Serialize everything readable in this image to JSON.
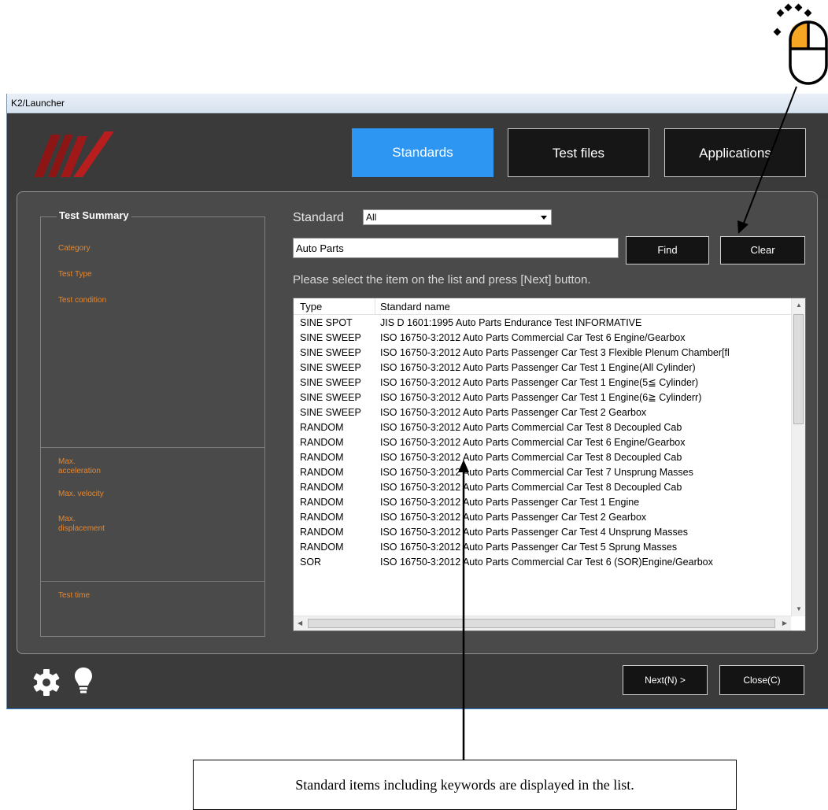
{
  "window": {
    "title": "K2/Launcher"
  },
  "tabs": [
    {
      "label": "Standards",
      "active": true
    },
    {
      "label": "Test files",
      "active": false
    },
    {
      "label": "Applications",
      "active": false
    }
  ],
  "summary": {
    "title": "Test Summary",
    "category": "Category",
    "test_type": "Test Type",
    "test_condition": "Test condition",
    "max_acceleration": "Max.\nacceleration",
    "max_velocity": "Max. velocity",
    "max_displacement": "Max.\ndisplacement",
    "test_time": "Test time"
  },
  "filter": {
    "standard_label": "Standard",
    "standard_value": "All",
    "search_value": "Auto Parts",
    "find_label": "Find",
    "clear_label": "Clear",
    "instruction": "Please select the item on the list and press [Next] button."
  },
  "list": {
    "headers": [
      "Type",
      "Standard name"
    ],
    "rows": [
      {
        "type": "SINE SPOT",
        "name": "JIS D 1601:1995 Auto Parts Endurance Test INFORMATIVE"
      },
      {
        "type": "SINE SWEEP",
        "name": "ISO 16750-3:2012 Auto Parts Commercial Car Test 6 Engine/Gearbox"
      },
      {
        "type": "SINE SWEEP",
        "name": "ISO 16750-3:2012 Auto Parts Passenger Car Test 3 Flexible Plenum Chamber[fl"
      },
      {
        "type": "SINE SWEEP",
        "name": "ISO 16750-3:2012 Auto Parts Passenger Car Test 1 Engine(All Cylinder)"
      },
      {
        "type": "SINE SWEEP",
        "name": "ISO 16750-3:2012 Auto Parts Passenger Car Test 1 Engine(5≦ Cylinder)"
      },
      {
        "type": "SINE SWEEP",
        "name": "ISO 16750-3:2012 Auto Parts Passenger Car Test 1 Engine(6≧ Cylinderr)"
      },
      {
        "type": "SINE SWEEP",
        "name": "ISO 16750-3:2012 Auto Parts Passenger Car Test 2 Gearbox"
      },
      {
        "type": "RANDOM",
        "name": "ISO 16750-3:2012 Auto Parts Commercial Car Test 8 Decoupled Cab"
      },
      {
        "type": "RANDOM",
        "name": "ISO 16750-3:2012 Auto Parts Commercial Car Test 6 Engine/Gearbox"
      },
      {
        "type": "RANDOM",
        "name": "ISO 16750-3:2012 Auto Parts Commercial Car Test 8 Decoupled Cab"
      },
      {
        "type": "RANDOM",
        "name": "ISO 16750-3:2012 Auto Parts Commercial Car Test 7 Unsprung Masses"
      },
      {
        "type": "RANDOM",
        "name": "ISO 16750-3:2012 Auto Parts Commercial Car Test 8 Decoupled Cab"
      },
      {
        "type": "RANDOM",
        "name": "ISO 16750-3:2012 Auto Parts Passenger Car Test 1 Engine"
      },
      {
        "type": "RANDOM",
        "name": "ISO 16750-3:2012 Auto Parts Passenger Car Test 2 Gearbox"
      },
      {
        "type": "RANDOM",
        "name": "ISO 16750-3:2012 Auto Parts Passenger Car Test 4 Unsprung Masses"
      },
      {
        "type": "RANDOM",
        "name": "ISO 16750-3:2012 Auto Parts Passenger Car Test 5 Sprung Masses"
      },
      {
        "type": "SOR",
        "name": "ISO 16750-3:2012 Auto Parts Commercial Car Test 6 (SOR)Engine/Gearbox"
      }
    ]
  },
  "footer": {
    "next_label": "Next(N) >",
    "close_label": "Close(C)"
  },
  "annotation": {
    "callout": "Standard items including keywords are displayed in the list."
  },
  "icons": {
    "settings": "gear-icon",
    "tips": "lightbulb-icon",
    "mouse": "mouse-left-click-icon"
  },
  "colors": {
    "active_tab": "#2d96f3",
    "summary_label": "#e8862c",
    "mouse_button": "#f5a623"
  }
}
